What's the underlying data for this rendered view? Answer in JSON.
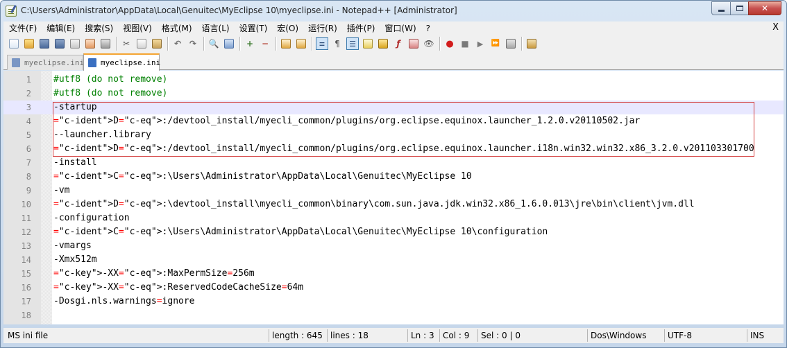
{
  "window": {
    "title": "C:\\Users\\Administrator\\AppData\\Local\\Genuitec\\MyEclipse 10\\myeclipse.ini - Notepad++ [Administrator]"
  },
  "menu": {
    "items": [
      "文件(F)",
      "编辑(E)",
      "搜索(S)",
      "视图(V)",
      "格式(M)",
      "语言(L)",
      "设置(T)",
      "宏(O)",
      "运行(R)",
      "插件(P)",
      "窗口(W)",
      "?"
    ],
    "close_label": "X"
  },
  "tabs": [
    {
      "label": "myeclipse.ini",
      "active": false
    },
    {
      "label": "myeclipse.ini",
      "active": true
    }
  ],
  "editor": {
    "current_line": 3,
    "highlighted_lines": [
      3,
      6
    ],
    "lines": [
      {
        "num": "1",
        "text": "#utf8 (do not remove)"
      },
      {
        "num": "2",
        "text": "#utf8 (do not remove)"
      },
      {
        "num": "3",
        "text": "-startup"
      },
      {
        "num": "4",
        "text": "D:/devtool_install/myecli_common/plugins/org.eclipse.equinox.launcher_1.2.0.v20110502.jar"
      },
      {
        "num": "5",
        "text": "--launcher.library"
      },
      {
        "num": "6",
        "text": "D:/devtool_install/myecli_common/plugins/org.eclipse.equinox.launcher.i18n.win32.win32.x86_3.2.0.v201103301700"
      },
      {
        "num": "7",
        "text": "-install"
      },
      {
        "num": "8",
        "text": "C:\\Users\\Administrator\\AppData\\Local\\Genuitec\\MyEclipse 10"
      },
      {
        "num": "9",
        "text": "-vm"
      },
      {
        "num": "10",
        "text": "D:\\devtool_install\\myecli_common\\binary\\com.sun.java.jdk.win32.x86_1.6.0.013\\jre\\bin\\client\\jvm.dll"
      },
      {
        "num": "11",
        "text": "-configuration"
      },
      {
        "num": "12",
        "text": "C:\\Users\\Administrator\\AppData\\Local\\Genuitec\\MyEclipse 10\\configuration"
      },
      {
        "num": "13",
        "text": "-vmargs"
      },
      {
        "num": "14",
        "text": "-Xmx512m"
      },
      {
        "num": "15",
        "text": "-XX:MaxPermSize=256m"
      },
      {
        "num": "16",
        "text": "-XX:ReservedCodeCacheSize=64m"
      },
      {
        "num": "17",
        "text": "-Dosgi.nls.warnings=ignore"
      },
      {
        "num": "18",
        "text": ""
      }
    ]
  },
  "status": {
    "file_type": "MS ini file",
    "length": "length : 645",
    "lines": "lines : 18",
    "ln": "Ln : 3",
    "col": "Col : 9",
    "sel": "Sel : 0 | 0",
    "eol": "Dos\\Windows",
    "encoding": "UTF-8",
    "mode": "INS"
  },
  "colors": {
    "comment": "#008000",
    "identifier": "#000080",
    "operator": "#ff0000",
    "current_line": "#e8e8ff",
    "highlight_box": "#d33b3b"
  }
}
